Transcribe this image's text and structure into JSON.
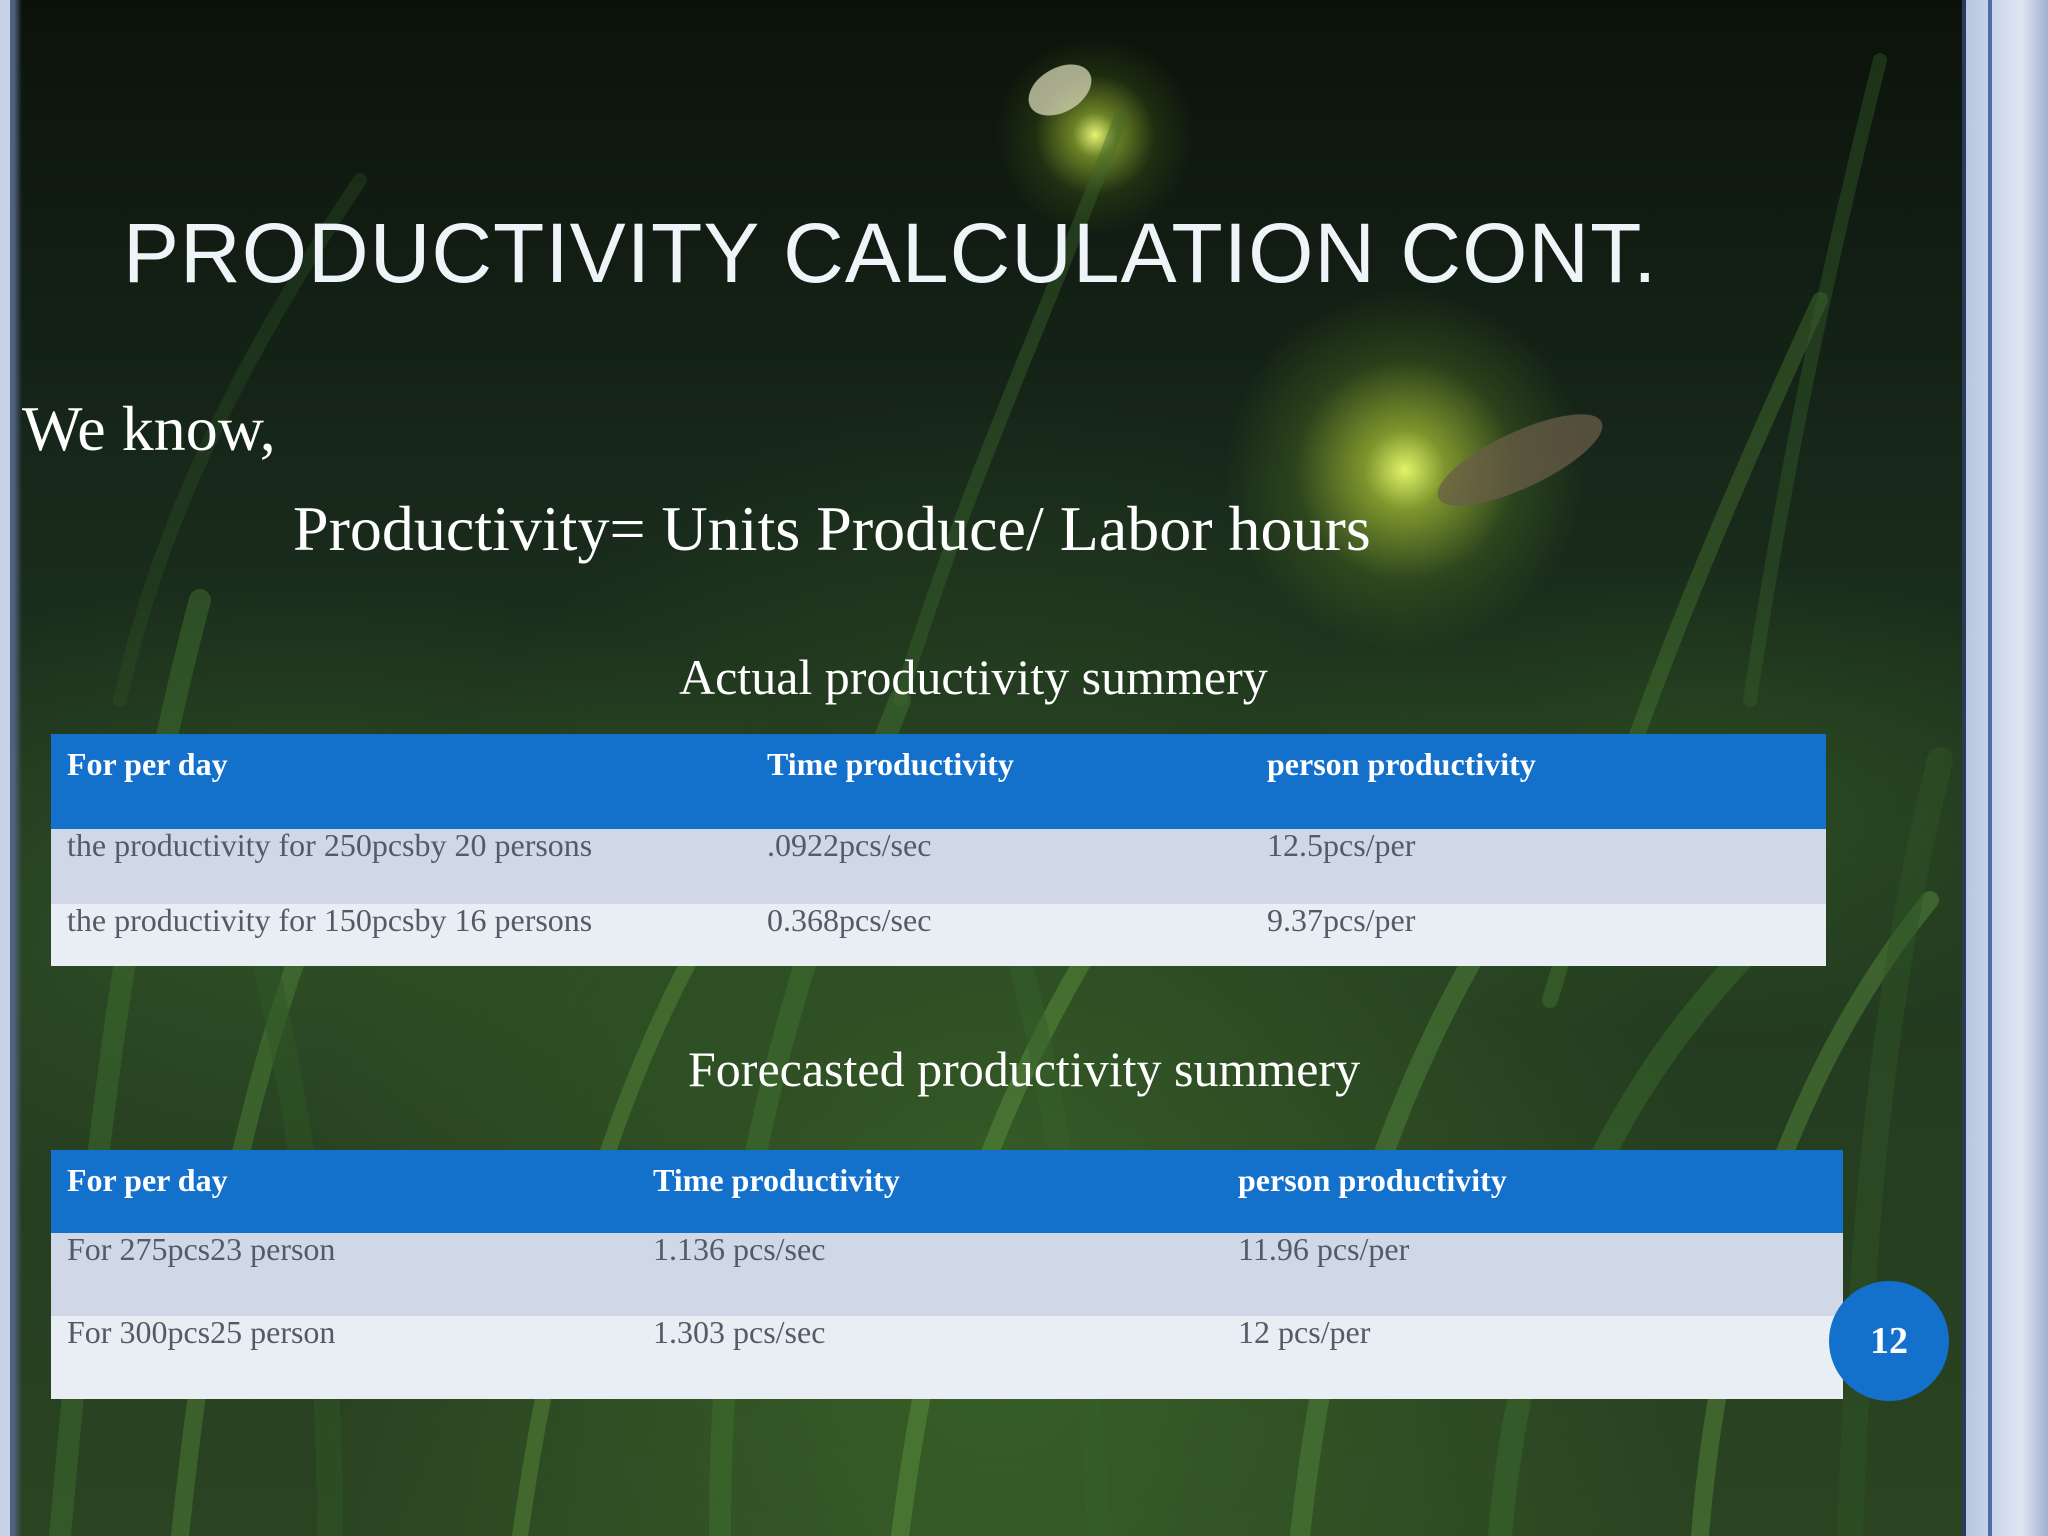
{
  "slide": {
    "title": "PRODUCTIVITY CALCULATION CONT.",
    "intro": "We know,",
    "formula": "Productivity= Units Produce/ Labor hours",
    "page_number": "12"
  },
  "actual_summary": {
    "caption": "Actual productivity summery",
    "headers": [
      "For per day",
      "Time productivity",
      "person productivity"
    ],
    "rows": [
      [
        "the productivity for 250pcsby 20 persons",
        ".0922pcs/sec",
        "12.5pcs/per"
      ],
      [
        "the productivity for 150pcsby 16 persons",
        "0.368pcs/sec",
        "9.37pcs/per"
      ]
    ]
  },
  "forecast_summary": {
    "caption": "Forecasted productivity summery",
    "headers": [
      "For per day",
      "Time productivity",
      "person productivity"
    ],
    "rows": [
      [
        "For 275pcs23 person",
        "1.136 pcs/sec",
        "11.96 pcs/per"
      ],
      [
        "For 300pcs25 person",
        "1.303 pcs/sec",
        "12 pcs/per"
      ]
    ]
  },
  "colors": {
    "table_header": "#1370cb",
    "row_odd": "#d0d8e8",
    "row_even": "#e9edf4",
    "badge": "#1370cb"
  }
}
